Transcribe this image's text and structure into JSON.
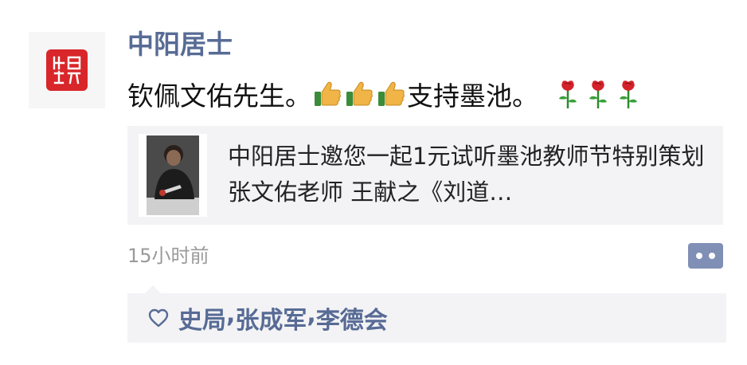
{
  "post": {
    "author": "中阳居士",
    "text_part1": "钦佩文佑先生。",
    "text_part2": "支持墨池。",
    "emoji_thumbs": [
      "thumbs-up-icon",
      "thumbs-up-icon",
      "thumbs-up-icon"
    ],
    "emoji_roses": [
      "rose-icon",
      "rose-icon",
      "rose-icon"
    ],
    "timestamp": "15小时前"
  },
  "link_card": {
    "title": "中阳居士邀您一起1元试听墨池教师节特别策划 张文佑老师 王献之《刘道…"
  },
  "likes": {
    "names": [
      "史局",
      "张成军",
      "李德会"
    ],
    "separator": ", "
  },
  "colors": {
    "name_blue": "#576b95",
    "seal_red": "#d8262a",
    "panel_gray": "#f3f3f5",
    "comment_button": "#7f8fb5"
  }
}
